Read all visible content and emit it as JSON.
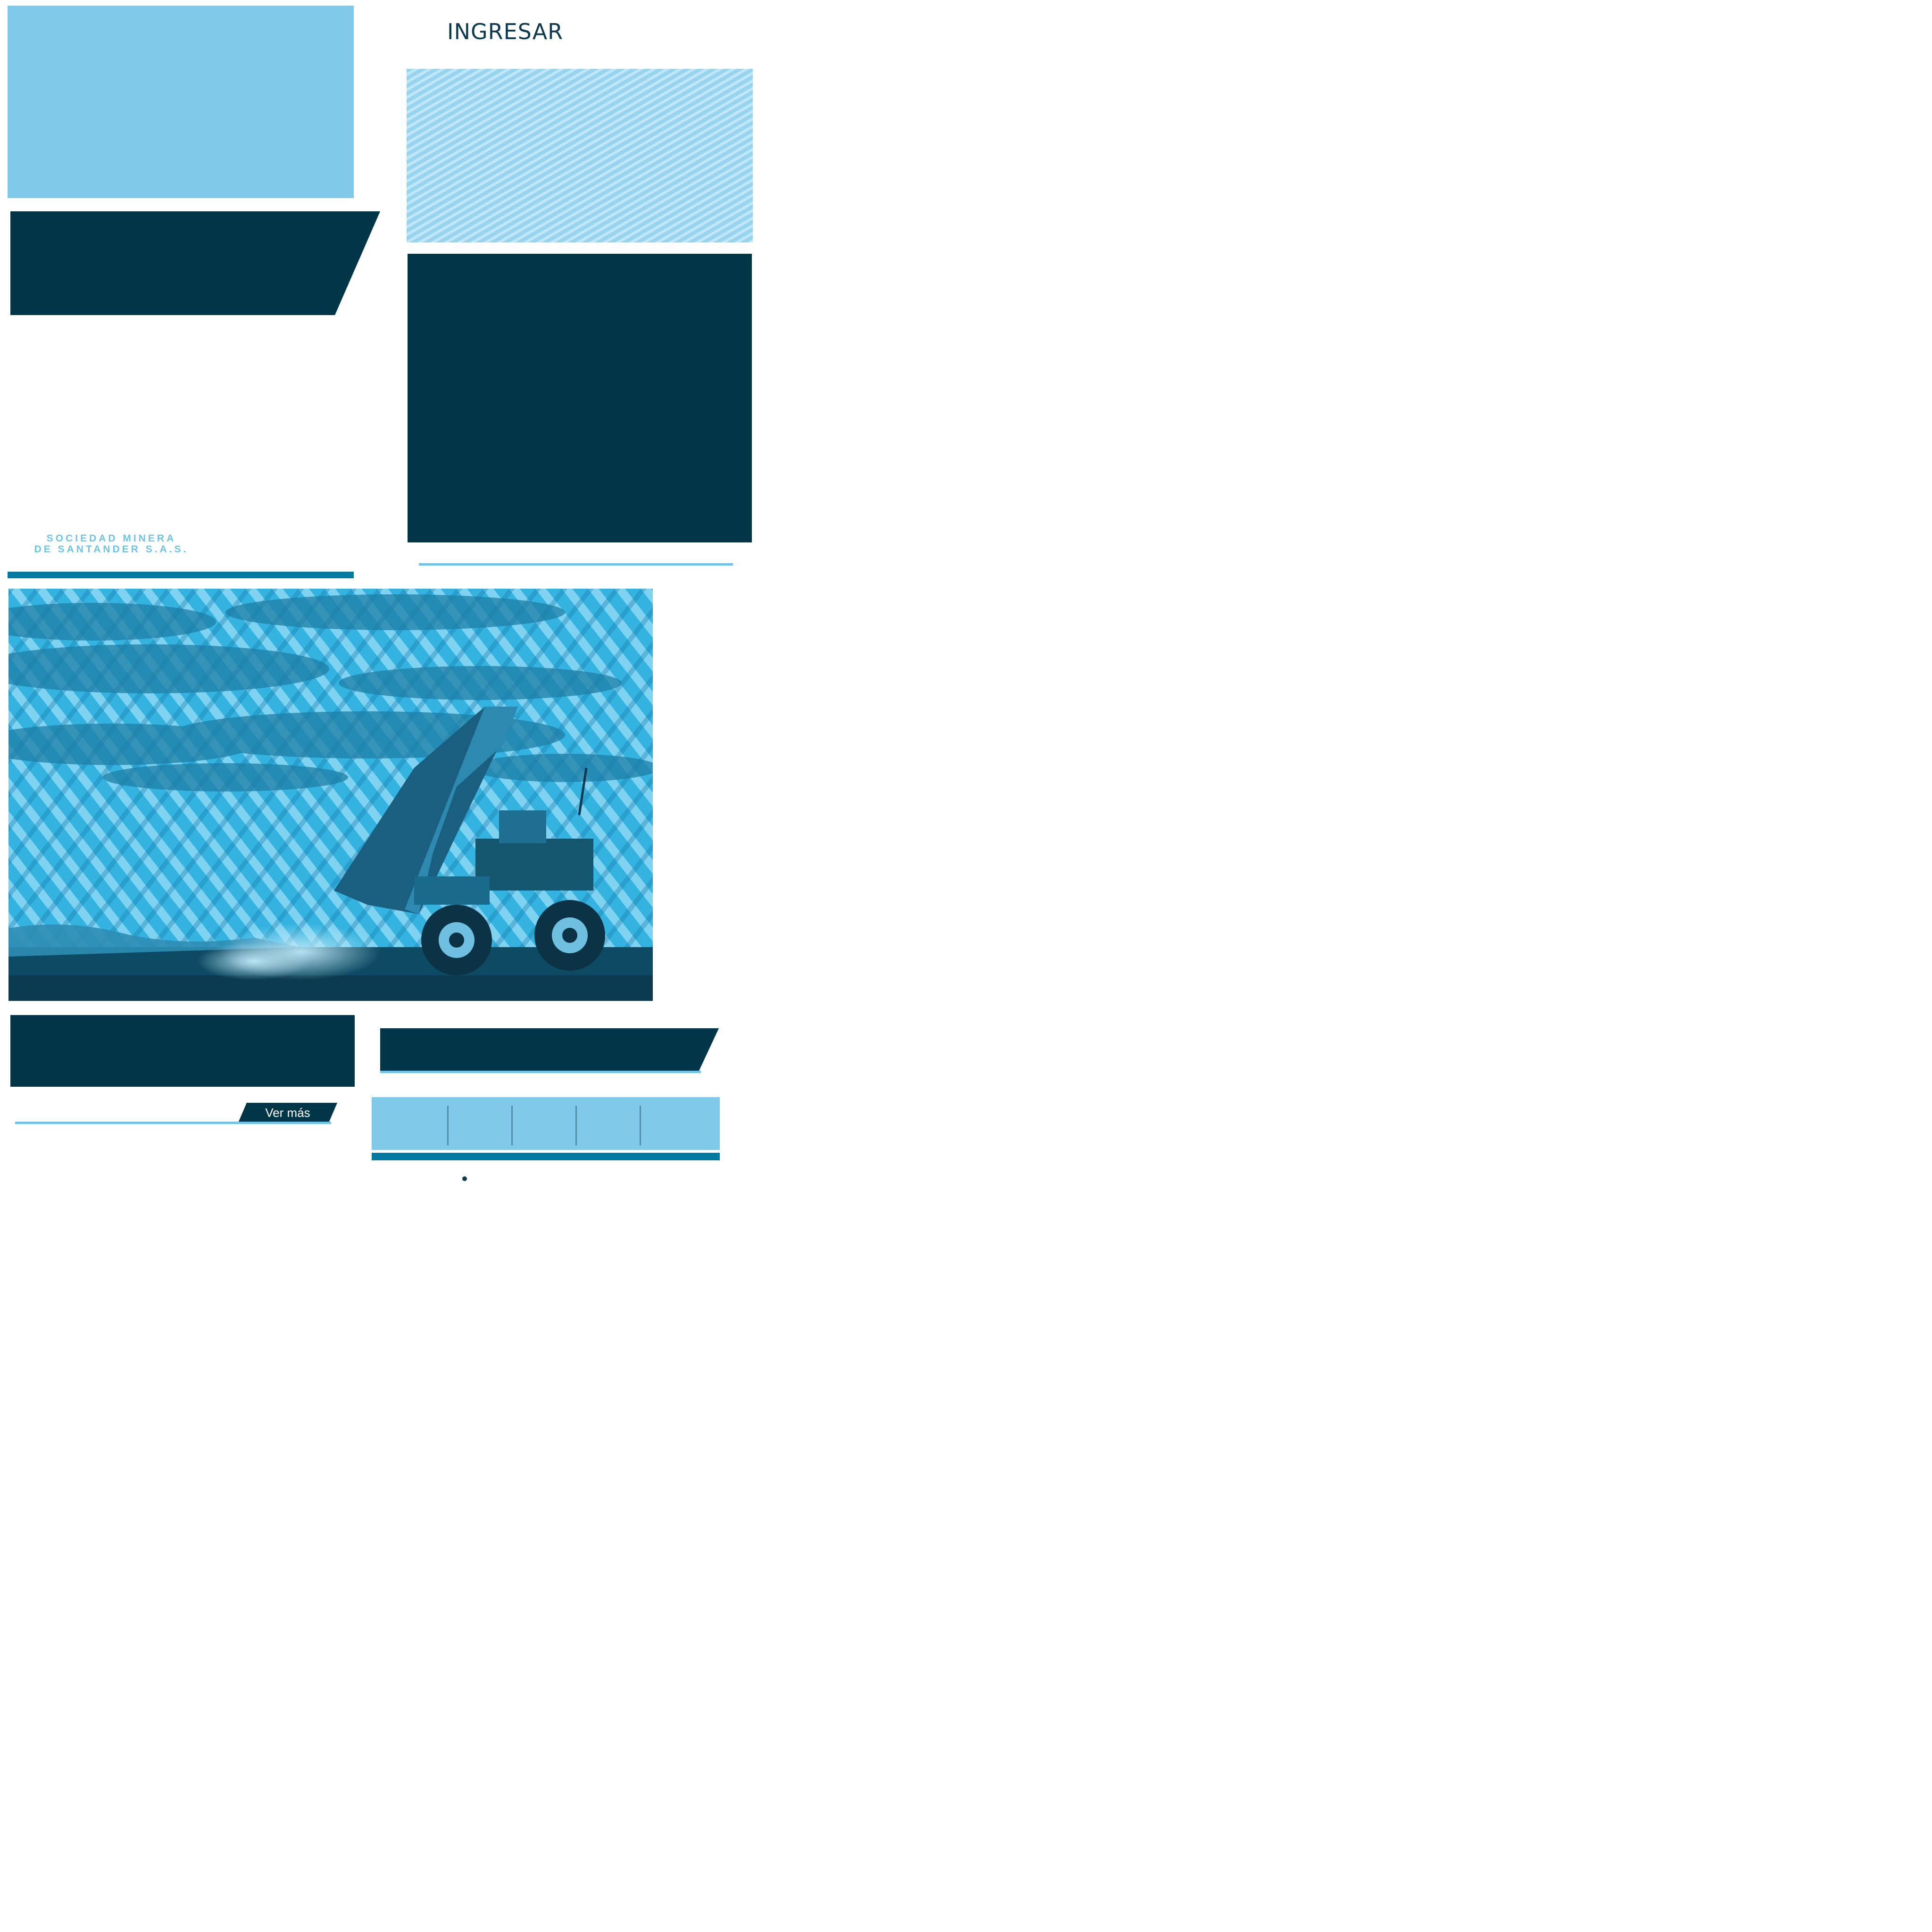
{
  "header": {
    "login_label": "INGRESAR"
  },
  "brand": {
    "logo_line1": "SOCIEDAD MINERA",
    "logo_line2": "DE SANTANDER S.A.S."
  },
  "news": {
    "see_more_label": "Ver más"
  },
  "colors": {
    "light_blue": "#80c9e8",
    "dark_teal": "#003648",
    "accent_blue": "#047aa0",
    "line_blue": "#6ec3e6"
  },
  "hero": {
    "image_subject": "mining-dump-truck"
  },
  "tabs": {
    "count": 5
  }
}
